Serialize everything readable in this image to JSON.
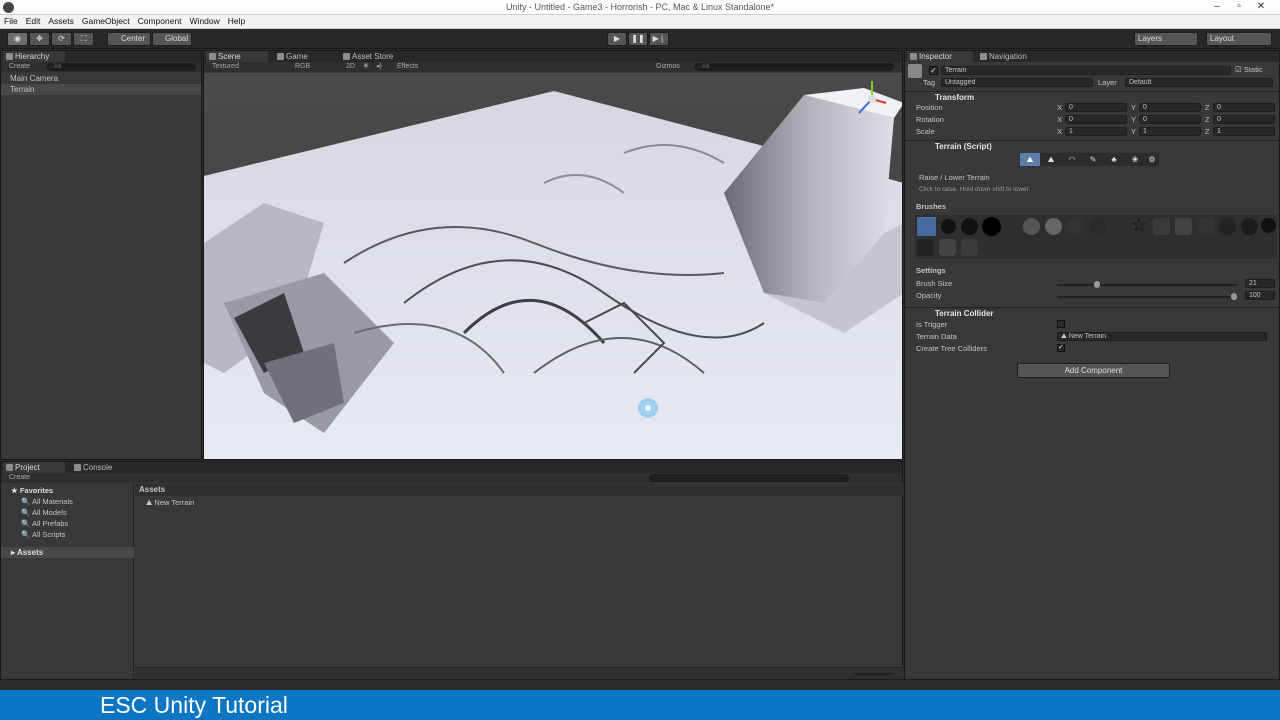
{
  "window": {
    "title": "Unity - Untitled - Game3 - Horrorish - PC, Mac & Linux Standalone*"
  },
  "menu": [
    "File",
    "Edit",
    "Assets",
    "GameObject",
    "Component",
    "Window",
    "Help"
  ],
  "toolbar": {
    "tools": [
      "hand-tool",
      "move-tool",
      "rotate-tool",
      "scale-tool"
    ],
    "pivot_label": "Center",
    "space_label": "Global",
    "layers_label": "Layers",
    "layout_label": "Layout"
  },
  "hierarchy": {
    "tab": "Hierarchy",
    "create": "Create",
    "search": "All",
    "items": [
      "Main Camera",
      "Terrain"
    ],
    "selected": "Terrain"
  },
  "scene": {
    "tabs": [
      "Scene",
      "Game",
      "Asset Store"
    ],
    "shading_mode": "Textured",
    "render_mode": "RGB",
    "mode_2d": "2D",
    "effects": "Effects",
    "gizmos": "Gizmos",
    "search": "All"
  },
  "inspector": {
    "tabs": [
      "Inspector",
      "Navigation"
    ],
    "object_name": "Terrain",
    "static_label": "Static",
    "tag_label": "Tag",
    "tag_value": "Untagged",
    "layer_label": "Layer",
    "layer_value": "Default",
    "transform": {
      "title": "Transform",
      "position_label": "Position",
      "rotation_label": "Rotation",
      "scale_label": "Scale",
      "axes": [
        "X",
        "Y",
        "Z"
      ],
      "position": [
        "0",
        "0",
        "0"
      ],
      "rotation": [
        "0",
        "0",
        "0"
      ],
      "scale": [
        "1",
        "1",
        "1"
      ]
    },
    "terrain_script": {
      "title": "Terrain (Script)",
      "tool_name": "Raise / Lower Terrain",
      "tool_hint": "Click to raise. Hold down shift to lower.",
      "brushes_label": "Brushes",
      "settings_label": "Settings",
      "brush_size_label": "Brush Size",
      "brush_size_value": "21",
      "brush_size_fraction": 0.21,
      "opacity_label": "Opacity",
      "opacity_value": "100",
      "opacity_fraction": 1.0
    },
    "terrain_collider": {
      "title": "Terrain Collider",
      "is_trigger_label": "Is Trigger",
      "is_trigger": false,
      "terrain_data_label": "Terrain Data",
      "terrain_data_value": "New Terrain",
      "tree_colliders_label": "Create Tree Colliders",
      "tree_colliders": true
    },
    "add_component_label": "Add Component"
  },
  "project": {
    "tabs": [
      "Project",
      "Console"
    ],
    "create": "Create",
    "favorites_label": "Favorites",
    "favorites": [
      "All Materials",
      "All Models",
      "All Prefabs",
      "All Scripts"
    ],
    "assets_root": "Assets",
    "breadcrumb": "Assets",
    "asset_items": [
      "New Terrain"
    ]
  },
  "footer": {
    "text": "ESC Unity Tutorial"
  },
  "colors": {
    "accent": "#0c76c4",
    "panel": "#383838",
    "selection": "#3e5f96"
  }
}
